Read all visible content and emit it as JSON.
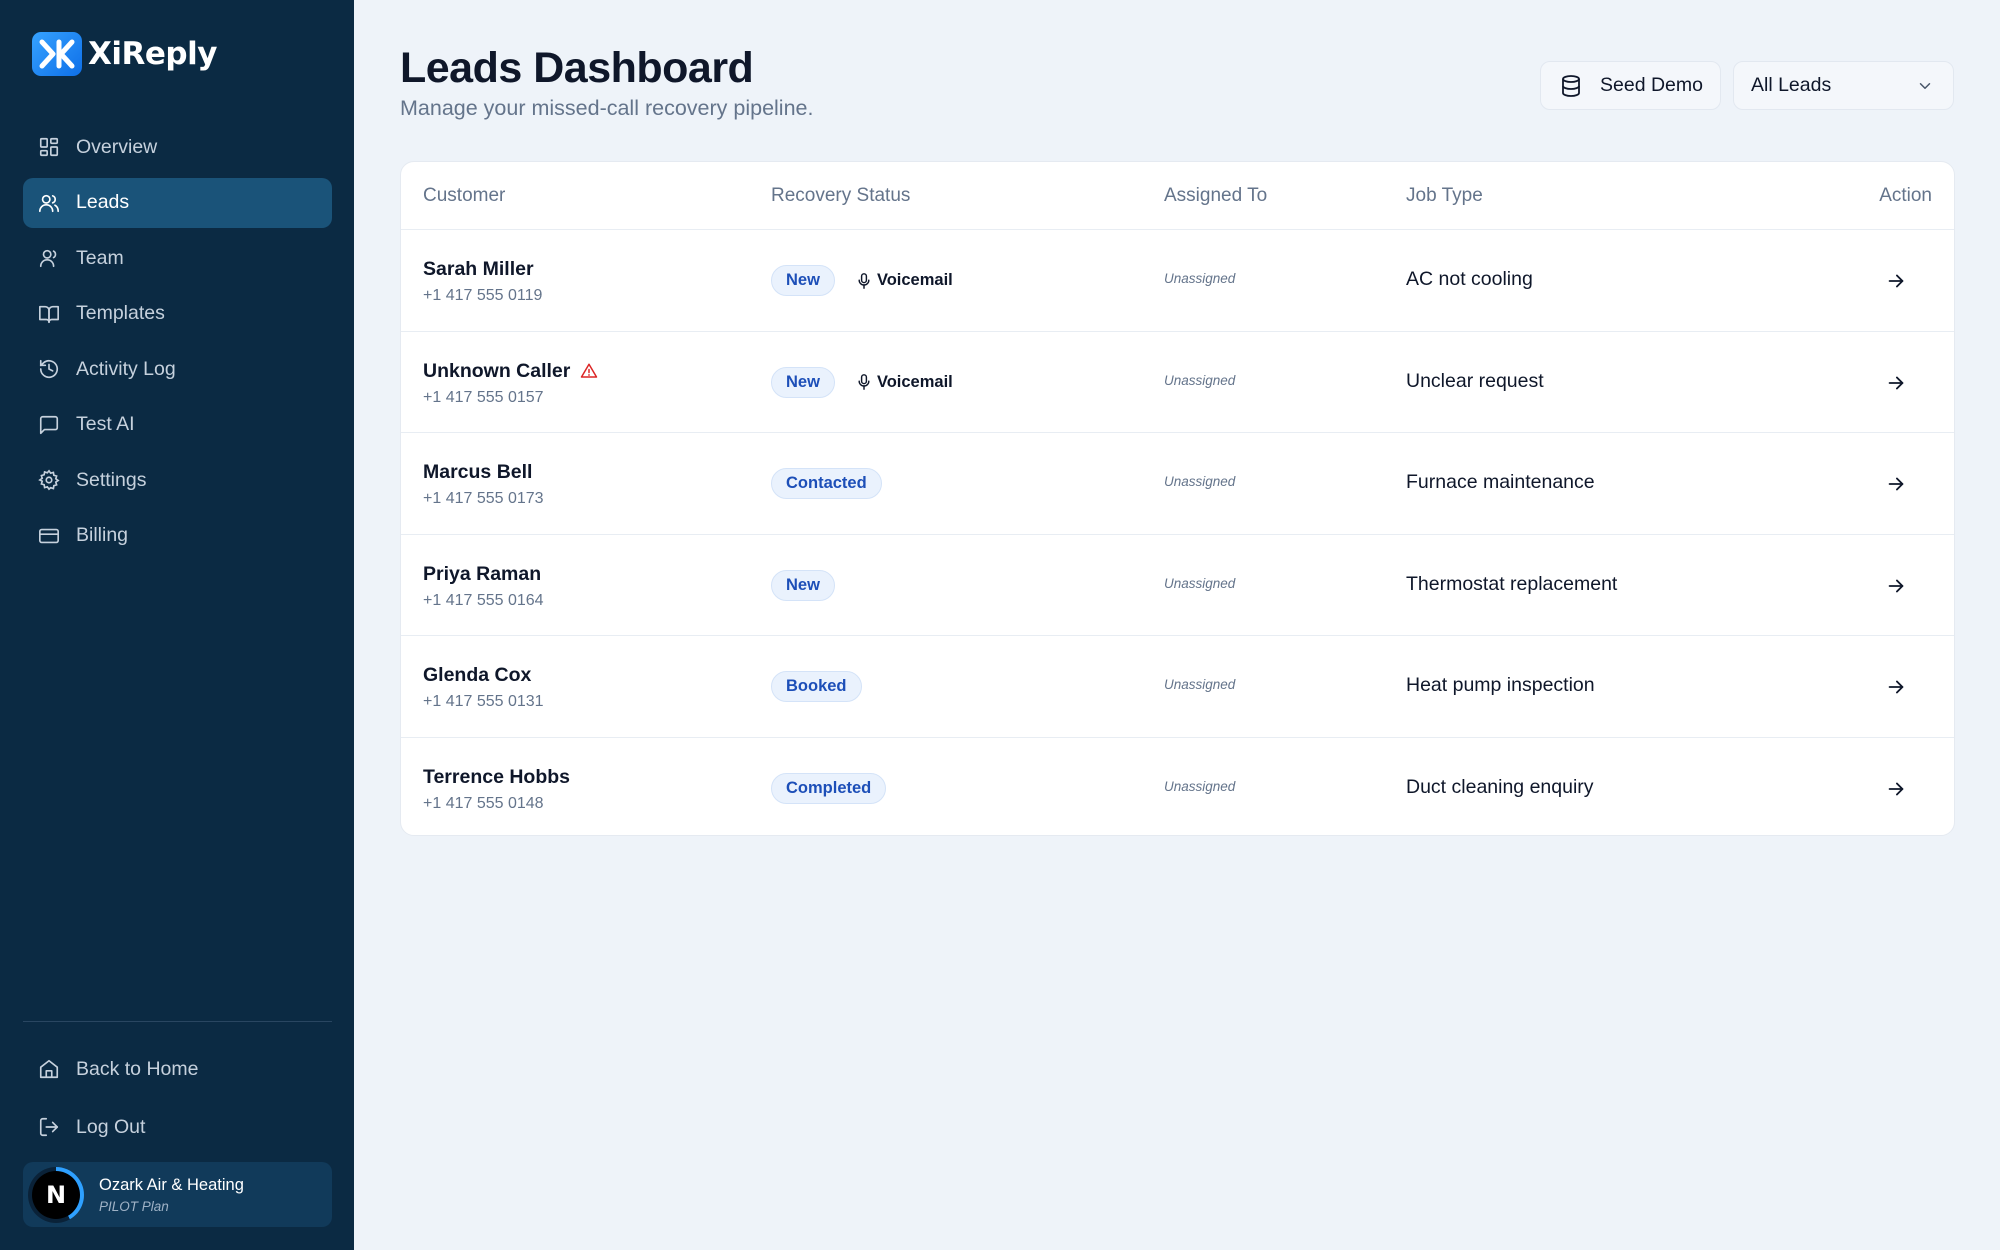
{
  "brand": {
    "name": "XiReply"
  },
  "sidebar": {
    "items": [
      {
        "label": "Overview",
        "icon": "dashboard-icon",
        "active": false
      },
      {
        "label": "Leads",
        "icon": "users-icon",
        "active": true
      },
      {
        "label": "Team",
        "icon": "user-icon",
        "active": false
      },
      {
        "label": "Templates",
        "icon": "book-icon",
        "active": false
      },
      {
        "label": "Activity Log",
        "icon": "history-icon",
        "active": false
      },
      {
        "label": "Test AI",
        "icon": "chat-icon",
        "active": false
      },
      {
        "label": "Settings",
        "icon": "gear-icon",
        "active": false
      },
      {
        "label": "Billing",
        "icon": "credit-card-icon",
        "active": false
      }
    ],
    "bottom_items": [
      {
        "label": "Back to Home",
        "icon": "home-icon"
      },
      {
        "label": "Log Out",
        "icon": "logout-icon"
      }
    ],
    "account": {
      "name": "Ozark Air & Heating",
      "plan": "PILOT Plan",
      "avatar_letter": "N"
    }
  },
  "header": {
    "title": "Leads Dashboard",
    "subtitle": "Manage your missed-call recovery pipeline.",
    "seed_button": "Seed Demo",
    "filter_selected": "All Leads"
  },
  "table": {
    "columns": {
      "customer": "Customer",
      "status": "Recovery Status",
      "assigned": "Assigned To",
      "job": "Job Type",
      "action": "Action"
    },
    "rows": [
      {
        "name": "Sarah Miller",
        "phone": "+1 417 555 0119",
        "status": "New",
        "voicemail": "Voicemail",
        "warning": false,
        "assigned": "Unassigned",
        "job": "AC not cooling"
      },
      {
        "name": "Unknown Caller",
        "phone": "+1 417 555 0157",
        "status": "New",
        "voicemail": "Voicemail",
        "warning": true,
        "assigned": "Unassigned",
        "job": "Unclear request"
      },
      {
        "name": "Marcus Bell",
        "phone": "+1 417 555 0173",
        "status": "Contacted",
        "voicemail": "",
        "warning": false,
        "assigned": "Unassigned",
        "job": "Furnace maintenance"
      },
      {
        "name": "Priya Raman",
        "phone": "+1 417 555 0164",
        "status": "New",
        "voicemail": "",
        "warning": false,
        "assigned": "Unassigned",
        "job": "Thermostat replacement"
      },
      {
        "name": "Glenda Cox",
        "phone": "+1 417 555 0131",
        "status": "Booked",
        "voicemail": "",
        "warning": false,
        "assigned": "Unassigned",
        "job": "Heat pump inspection"
      },
      {
        "name": "Terrence Hobbs",
        "phone": "+1 417 555 0148",
        "status": "Completed",
        "voicemail": "",
        "warning": false,
        "assigned": "Unassigned",
        "job": "Duct cleaning enquiry"
      }
    ]
  },
  "colors": {
    "sidebar_bg": "#0b2a43",
    "active_nav": "#1a5379",
    "accent": "#1d4fb8",
    "page_bg": "#eef3f9",
    "warning": "#dc2626"
  }
}
